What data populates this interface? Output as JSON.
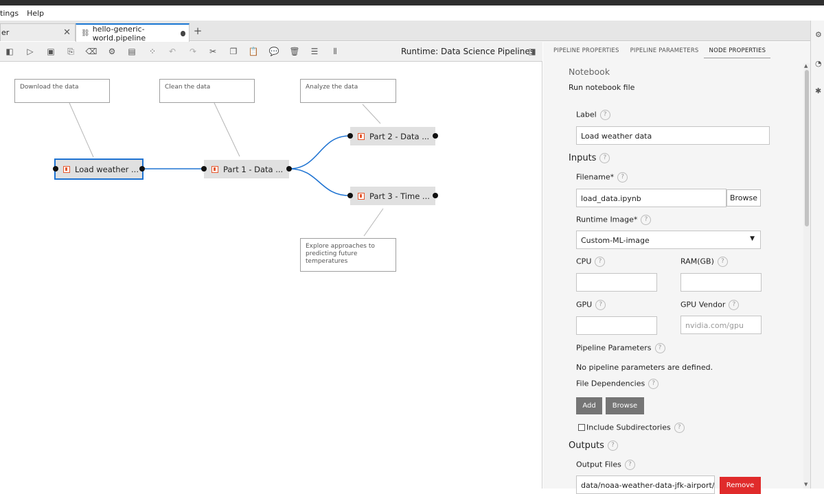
{
  "menu": {
    "items": [
      "tings",
      "Help"
    ]
  },
  "tabs": [
    {
      "label": "er",
      "closable": true,
      "active": false
    },
    {
      "label": "hello-generic-world.pipeline",
      "active": true,
      "modified": true
    }
  ],
  "tab_add_label": "+",
  "toolbar": {
    "runtime_label": "Runtime: Data Science Pipelines",
    "icons": [
      "toggle-palette-icon",
      "run-icon",
      "save-icon",
      "export-icon",
      "clear-icon",
      "open-runtimes-icon",
      "open-runtime-images-icon",
      "open-component-catalogs-icon",
      "undo-icon",
      "redo-icon",
      "cut-icon",
      "copy-icon",
      "paste-icon",
      "add-comment-icon",
      "delete-icon",
      "arrange-horizontal-icon",
      "arrange-vertical-icon",
      "toggle-properties-icon"
    ]
  },
  "canvas": {
    "comments": [
      {
        "text": "Download the data"
      },
      {
        "text": "Clean the data"
      },
      {
        "text": "Analyze the data"
      },
      {
        "text": "Explore approaches to predicting future temperatures"
      }
    ],
    "nodes": [
      {
        "label": "Load weather ...",
        "selected": true
      },
      {
        "label": "Part 1 - Data ..."
      },
      {
        "label": "Part 2 - Data ..."
      },
      {
        "label": "Part 3 - Time ..."
      }
    ]
  },
  "panel": {
    "tabs": [
      "PIPELINE PROPERTIES",
      "PIPELINE PARAMETERS",
      "NODE PROPERTIES"
    ],
    "active_tab": "NODE PROPERTIES",
    "section_title": "Notebook",
    "section_desc": "Run notebook file",
    "label_field": {
      "label": "Label",
      "value": "Load weather data"
    },
    "inputs_heading": "Inputs",
    "filename": {
      "label": "Filename*",
      "value": "load_data.ipynb",
      "browse": "Browse"
    },
    "runtime_image": {
      "label": "Runtime Image*",
      "value": "Custom-ML-image"
    },
    "cpu": {
      "label": "CPU",
      "value": ""
    },
    "ram": {
      "label": "RAM(GB)",
      "value": ""
    },
    "gpu": {
      "label": "GPU",
      "value": ""
    },
    "gpu_vendor": {
      "label": "GPU Vendor",
      "placeholder": "nvidia.com/gpu"
    },
    "pipeline_params": {
      "label": "Pipeline Parameters",
      "empty_text": "No pipeline parameters are defined."
    },
    "file_deps": {
      "label": "File Dependencies",
      "add": "Add",
      "browse": "Browse"
    },
    "include_subdirs": {
      "label": "Include Subdirectories",
      "checked": false
    },
    "outputs_heading": "Outputs",
    "output_files": {
      "label": "Output Files",
      "value": "data/noaa-weather-data-jfk-airport/jfk_w",
      "remove": "Remove"
    },
    "help_symbol": "?"
  },
  "colors": {
    "accent": "#1e73d2",
    "node_icon": "#e4572e",
    "remove_btn": "#e02b2b",
    "toolbar_btn": "#757575"
  }
}
